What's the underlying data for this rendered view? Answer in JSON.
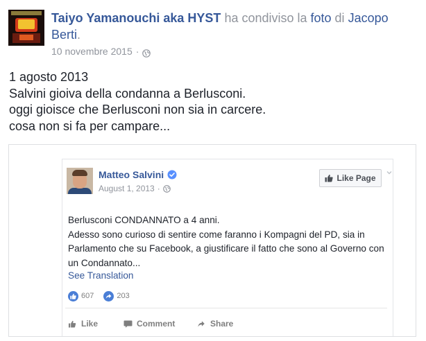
{
  "post": {
    "author": "Taiyo Yamanouchi aka HYST",
    "shared_text": " ha condiviso la ",
    "photo_link": "foto",
    "of_text": " di ",
    "owner": "Jacopo Berti",
    "period": ".",
    "date": "10 novembre 2015",
    "dot": "·",
    "body_lines": [
      "1 agosto 2013",
      "Salvini gioiva della condanna a Berlusconi.",
      "oggi gioisce che Berlusconi non sia in carcere.",
      "cosa non si fa per campare..."
    ]
  },
  "shared_photo": {
    "name": "Matteo Salvini",
    "date": "August 1, 2013",
    "dot": "·",
    "like_page_label": "Like Page",
    "text_lines": [
      "Berlusconi CONDANNATO a 4 anni.",
      "Adesso sono curioso di sentire come faranno i Kompagni del PD, sia in",
      "Parlamento che su Facebook, a giustificare il fatto che sono al Governo con",
      "un Condannato..."
    ],
    "see_translation": "See Translation",
    "likes_count": "607",
    "shares_count": "203",
    "actions": {
      "like": "Like",
      "comment": "Comment",
      "share": "Share"
    }
  },
  "colors": {
    "link_blue": "#365899",
    "muted_grey": "#90949c",
    "reaction_blue": "#4a7ed6"
  },
  "icons": [
    "globe-icon",
    "verified-icon",
    "thumb-icon",
    "chevron-down-icon",
    "like-reaction-icon",
    "share-reaction-icon",
    "comment-icon",
    "share-icon"
  ]
}
